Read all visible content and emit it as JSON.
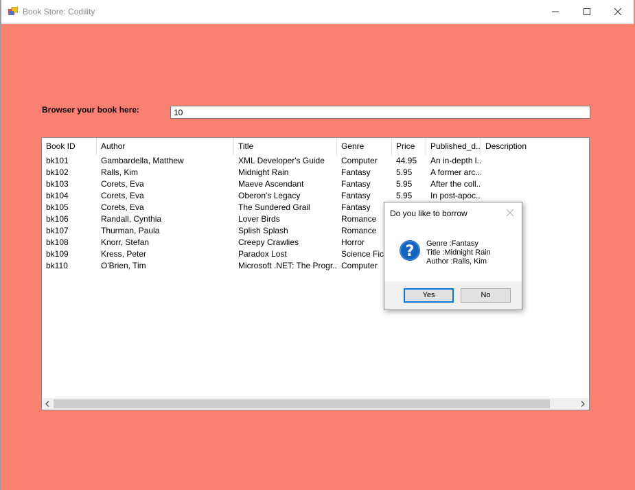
{
  "window": {
    "title": "Book Store: Codility",
    "controls": [
      "minimize-icon",
      "maximize-icon",
      "close-icon"
    ]
  },
  "colors": {
    "form_background": "#fa8072",
    "accent": "#0078d7"
  },
  "search": {
    "label": "Browser your book here:",
    "value": "10"
  },
  "grid": {
    "columns": [
      "Book ID",
      "Author",
      "Title",
      "Genre",
      "Price",
      "Published_d...",
      "Description"
    ],
    "rows": [
      [
        "bk101",
        "Gambardella, Matthew",
        "XML Developer's Guide",
        "Computer",
        "44.95",
        "An in-depth l...",
        ""
      ],
      [
        "bk102",
        "Ralls, Kim",
        "Midnight Rain",
        "Fantasy",
        "5.95",
        "A former arc...",
        ""
      ],
      [
        "bk103",
        "Corets, Eva",
        "Maeve Ascendant",
        "Fantasy",
        "5.95",
        "After the coll...",
        ""
      ],
      [
        "bk104",
        "Corets, Eva",
        "Oberon's Legacy",
        "Fantasy",
        "5.95",
        "In post-apoc...",
        ""
      ],
      [
        "bk105",
        "Corets, Eva",
        "The Sundered Grail",
        "Fantasy",
        "",
        "",
        ""
      ],
      [
        "bk106",
        "Randall, Cynthia",
        "Lover Birds",
        "Romance",
        "",
        "",
        ""
      ],
      [
        "bk107",
        "Thurman, Paula",
        "Splish Splash",
        "Romance",
        "",
        "",
        ""
      ],
      [
        "bk108",
        "Knorr, Stefan",
        "Creepy Crawlies",
        "Horror",
        "",
        "",
        ""
      ],
      [
        "bk109",
        "Kress, Peter",
        "Paradox Lost",
        "Science Fict...",
        "",
        "",
        ""
      ],
      [
        "bk110",
        "O'Brien, Tim",
        "Microsoft .NET: The Progr...",
        "Computer",
        "",
        "",
        ""
      ]
    ]
  },
  "dialog": {
    "title": "Do you like to borrow",
    "icon": "question-icon",
    "lines": [
      "Genre :Fantasy",
      "Title :Midnight Rain",
      "Author :Ralls, Kim"
    ],
    "yes_label": "Yes",
    "no_label": "No"
  }
}
